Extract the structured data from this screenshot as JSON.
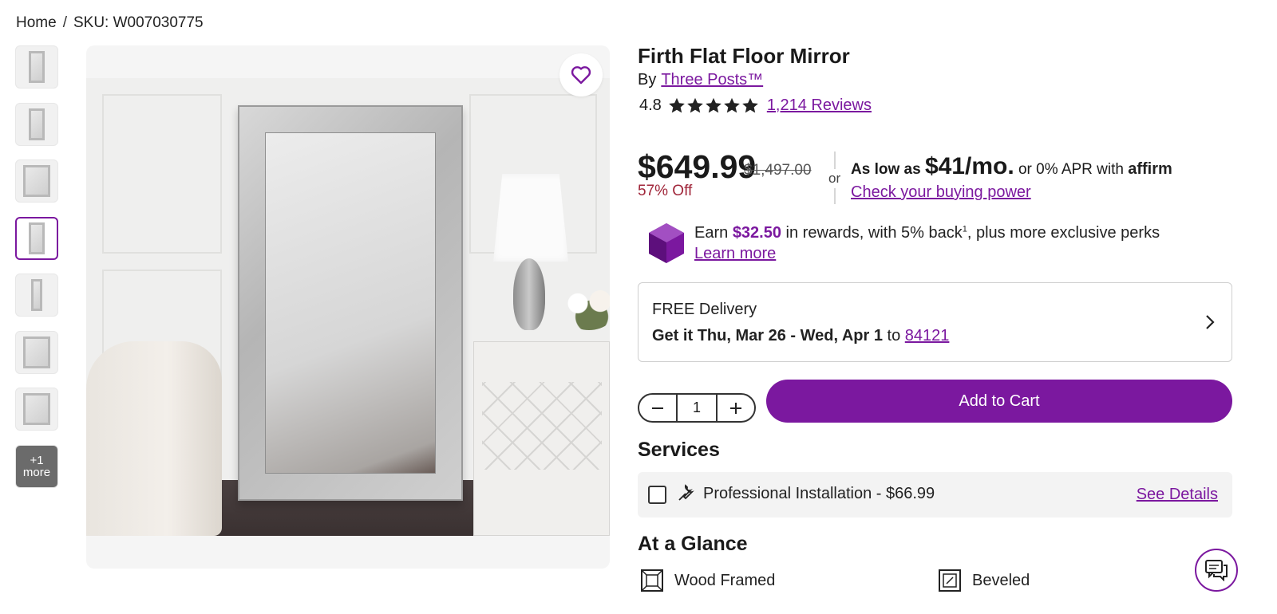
{
  "breadcrumb": {
    "home": "Home",
    "sep": "/",
    "sku": "SKU: W007030775"
  },
  "gallery": {
    "more_count": "+1",
    "more_label": "more"
  },
  "product": {
    "title": "Firth Flat Floor Mirror",
    "by_label": "By",
    "brand": "Three Posts™",
    "rating": "4.8",
    "reviews": "1,214 Reviews"
  },
  "pricing": {
    "price": "$649.99",
    "old_price": "$1,497.00",
    "discount": "57% Off",
    "or": "or",
    "affirm_prefix": "As low as",
    "affirm_amount": "$41/mo.",
    "affirm_mid": "or 0% APR with",
    "affirm_logo": "affirm",
    "affirm_link": "Check your buying power"
  },
  "rewards": {
    "earn": "Earn",
    "amount": "$32.50",
    "rest_a": "in rewards, with 5% back",
    "sup": "1",
    "rest_b": ", plus more exclusive perks",
    "link": "Learn more"
  },
  "delivery": {
    "title": "FREE Delivery",
    "prefix": "Get it",
    "dates": "Thu, Mar 26 - Wed, Apr 1",
    "to": "to",
    "zip": "84121"
  },
  "cart": {
    "quantity": "1",
    "add_label": "Add to Cart"
  },
  "services": {
    "heading": "Services",
    "item": "Professional Installation - $66.99",
    "details": "See Details"
  },
  "glance": {
    "heading": "At a Glance",
    "items": [
      {
        "label": "Wood Framed",
        "icon": "wood-frame-icon"
      },
      {
        "label": "Beveled",
        "icon": "beveled-icon"
      }
    ]
  },
  "colors": {
    "accent": "#7b189f",
    "discount": "#a0263a"
  }
}
